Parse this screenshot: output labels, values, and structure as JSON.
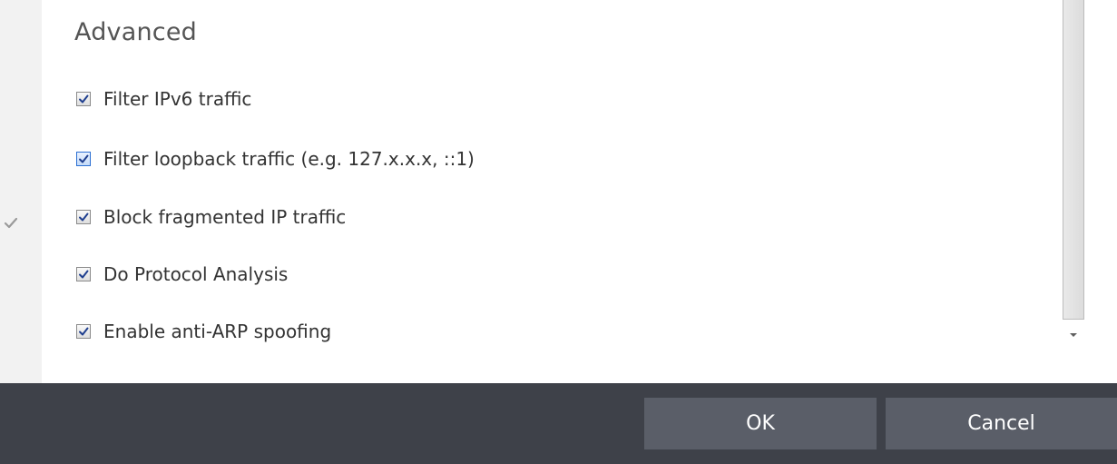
{
  "section": {
    "title": "Advanced"
  },
  "options": [
    {
      "label": "Filter IPv6 traffic",
      "checked": true
    },
    {
      "label": "Filter loopback traffic (e.g. 127.x.x.x, ::1)",
      "checked": true
    },
    {
      "label": "Block fragmented IP traffic",
      "checked": true
    },
    {
      "label": "Do Protocol Analysis",
      "checked": true
    },
    {
      "label": "Enable anti-ARP spoofing",
      "checked": true
    }
  ],
  "footer": {
    "ok_label": "OK",
    "cancel_label": "Cancel"
  },
  "icons": {
    "rail": "checkmark-icon",
    "checkbox": "checkmark-icon",
    "scroll": "arrow-down-icon"
  },
  "colors": {
    "footer_bg": "#3e4149",
    "button_bg": "#5a5e68",
    "checkmark": "#1f3f8f"
  }
}
